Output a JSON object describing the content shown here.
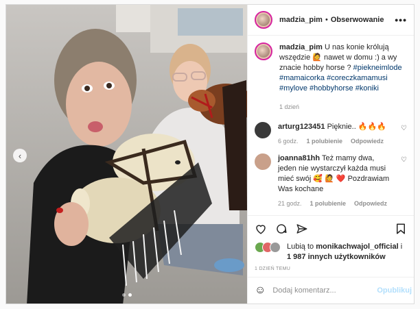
{
  "post": {
    "username": "madzia_pim",
    "follow_label": "Obserwowanie",
    "caption_user": "madzia_pim",
    "caption_text": "U nas konie królują wszędzie 🙋 nawet w domu :) a wy znacie hobby horse ?",
    "hashtags": [
      "#piekneimlode",
      "#mamaicorka",
      "#coreczkamamusi",
      "#mylove",
      "#hobbyhorse",
      "#koniki"
    ],
    "caption_time": "1 dzień",
    "carousel_dots": 2,
    "carousel_active": 1
  },
  "comments": [
    {
      "user": "arturg123451",
      "text": "Pięknie.. 🔥🔥🔥",
      "time": "6 godz.",
      "likes": "1 polubienie",
      "reply": "Odpowiedz",
      "avatar_color": "#3a3a3a"
    },
    {
      "user": "joanna81hh",
      "text": "Też mamy dwa, jeden nie wystarczył każda musi mieć swój 🥰 🙋 ❤️ Pozdrawiam Was kochane",
      "time": "21 godz.",
      "likes": "1 polubienie",
      "reply": "Odpowiedz",
      "avatar_color": "#c9a08a"
    }
  ],
  "likes": {
    "prefix": "Lubią to",
    "user": "monikachwajol_official",
    "joiner": "i",
    "others": "1 987 innych użytkowników",
    "liker_colors": [
      "#6aa84f",
      "#e06666",
      "#999999"
    ]
  },
  "time_ago": "1 DZIEŃ TEMU",
  "comment_box": {
    "placeholder": "Dodaj komentarz...",
    "publish_label": "Opublikuj"
  },
  "icons": [
    "heart-icon",
    "comment-icon",
    "share-icon",
    "bookmark-icon",
    "emoji-icon",
    "more-icon",
    "chevron-left-icon"
  ],
  "colors": {
    "link": "#00376b",
    "publish": "#b2dffc",
    "border": "#dbdbdb"
  }
}
